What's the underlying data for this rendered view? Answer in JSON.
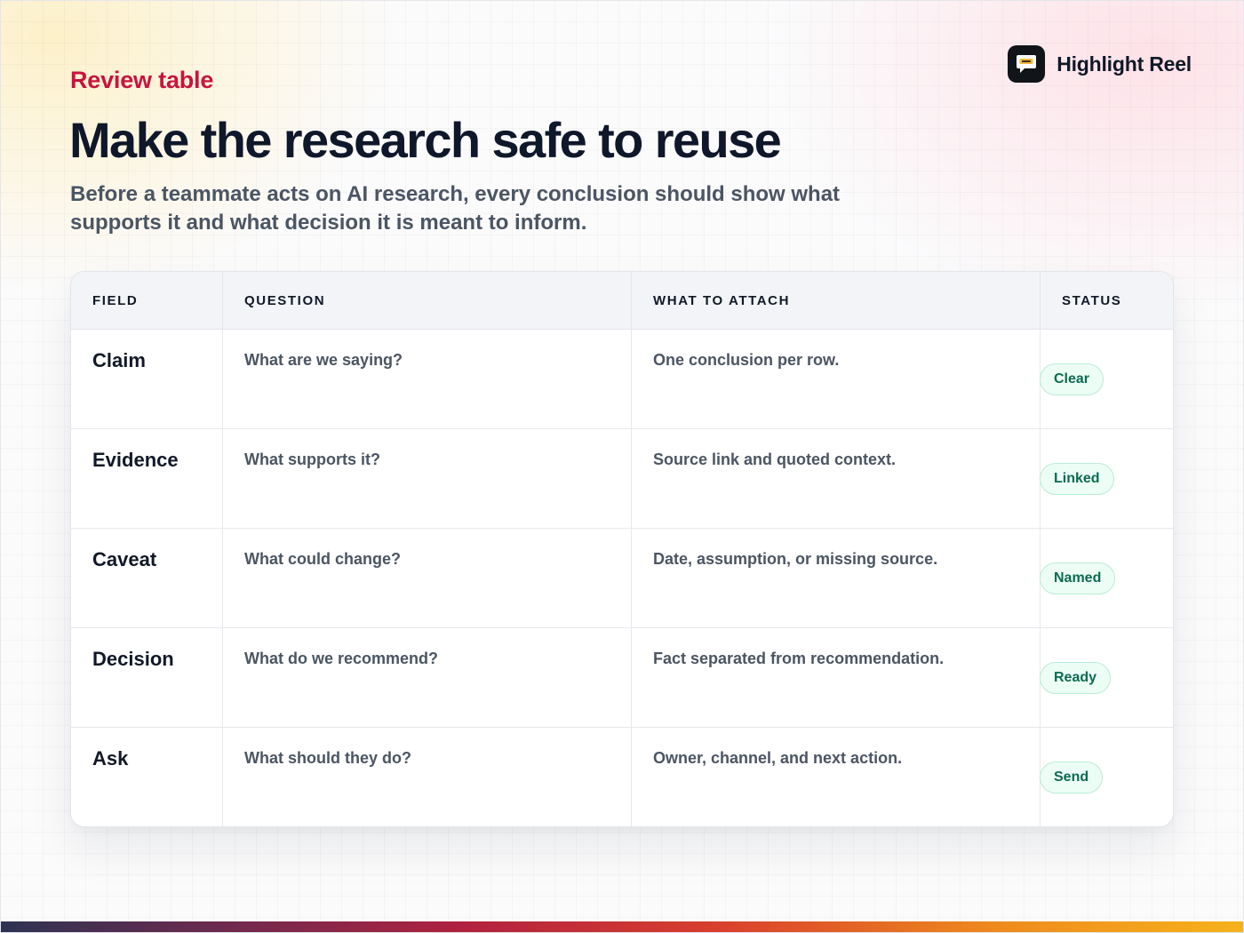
{
  "brand": {
    "name": "Highlight Reel",
    "logo_icon": "speech-bubble-icon"
  },
  "eyebrow": "Review table",
  "title": "Make the research safe to reuse",
  "subtitle": "Before a teammate acts on AI research, every conclusion should show what supports it and what decision it is meant to inform.",
  "table": {
    "headers": [
      "FIELD",
      "QUESTION",
      "WHAT TO ATTACH",
      "STATUS"
    ],
    "rows": [
      {
        "field": "Claim",
        "question": "What are we saying?",
        "attach": "One conclusion per row.",
        "status": "Clear"
      },
      {
        "field": "Evidence",
        "question": "What supports it?",
        "attach": "Source link and quoted context.",
        "status": "Linked"
      },
      {
        "field": "Caveat",
        "question": "What could change?",
        "attach": "Date, assumption, or missing source.",
        "status": "Named"
      },
      {
        "field": "Decision",
        "question": "What do we recommend?",
        "attach": "Fact separated from recommendation.",
        "status": "Ready"
      },
      {
        "field": "Ask",
        "question": "What should they do?",
        "attach": "Owner, channel, and next action.",
        "status": "Send"
      }
    ]
  },
  "colors": {
    "accent": "#c8143c",
    "status_bg": "#ecfdf5",
    "status_text": "#0b6b4f",
    "logo_bubble": "#f5b73b"
  }
}
